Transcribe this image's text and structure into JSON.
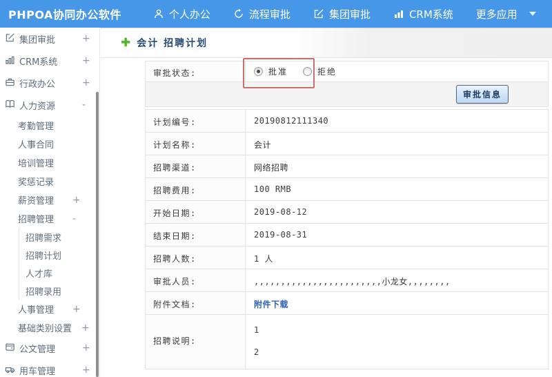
{
  "topbar": {
    "brand": "PHPOA协同办公软件",
    "nav": [
      {
        "label": "个人办公",
        "icon": "user-icon"
      },
      {
        "label": "流程审批",
        "icon": "process-icon"
      },
      {
        "label": "集团审批",
        "icon": "edit-icon"
      },
      {
        "label": "CRM系统",
        "icon": "chart-icon"
      },
      {
        "label": "更多应用",
        "icon": "caret-down-icon"
      }
    ]
  },
  "sidebar": {
    "items": [
      {
        "label": "集团审批",
        "icon": "edit-icon",
        "expander": "+"
      },
      {
        "label": "CRM系统",
        "icon": "chart-icon",
        "expander": "+"
      },
      {
        "label": "行政办公",
        "icon": "briefcase-icon",
        "expander": "+"
      },
      {
        "label": "人力资源",
        "icon": "book-icon",
        "expander": "-"
      },
      {
        "label": "考勤管理"
      },
      {
        "label": "人事合同"
      },
      {
        "label": "培训管理"
      },
      {
        "label": "奖惩记录"
      },
      {
        "label": "薪资管理",
        "expander": "+"
      },
      {
        "label": "招聘管理",
        "expander": "-"
      },
      {
        "label": "招聘需求"
      },
      {
        "label": "招聘计划"
      },
      {
        "label": "人才库"
      },
      {
        "label": "招聘录用"
      },
      {
        "label": "人事管理",
        "expander": "+"
      },
      {
        "label": "基础类别设置",
        "expander": "+"
      },
      {
        "label": "公文管理",
        "icon": "document-icon",
        "expander": "+"
      },
      {
        "label": "用车管理",
        "icon": "car-icon",
        "expander": "+"
      }
    ]
  },
  "content": {
    "title": "会计 招聘计划",
    "plus_icon": "✚",
    "approval": {
      "label": "审批状态:",
      "options": [
        {
          "label": "批准",
          "selected": true
        },
        {
          "label": "拒绝",
          "selected": false
        }
      ],
      "button_label": "审批信息"
    },
    "fields": [
      {
        "label": "计划编号:",
        "value": "20190812111340"
      },
      {
        "label": "计划名称:",
        "value": "会计"
      },
      {
        "label": "招聘渠道:",
        "value": "网络招聘"
      },
      {
        "label": "招聘费用:",
        "value": "100 RMB"
      },
      {
        "label": "开始日期:",
        "value": "2019-08-12"
      },
      {
        "label": "结束日期:",
        "value": "2019-08-31"
      },
      {
        "label": "招聘人数:",
        "value": "1 人"
      },
      {
        "label": "审批人员:",
        "value": ",,,,,,,,,,,,,,,,,,,,,,,,小龙女,,,,,,,,"
      },
      {
        "label": "附件文档:",
        "value": "附件下载",
        "type": "link"
      },
      {
        "label": "招聘说明:",
        "lines": [
          "1",
          "2"
        ]
      }
    ]
  },
  "colors": {
    "topbar_bg": "#4697e7",
    "title_text": "#264b73",
    "link": "#2f62b8",
    "annotation_red": "#c4706e",
    "plus_green": "#55b427",
    "button_face": "#bcd8f3"
  }
}
